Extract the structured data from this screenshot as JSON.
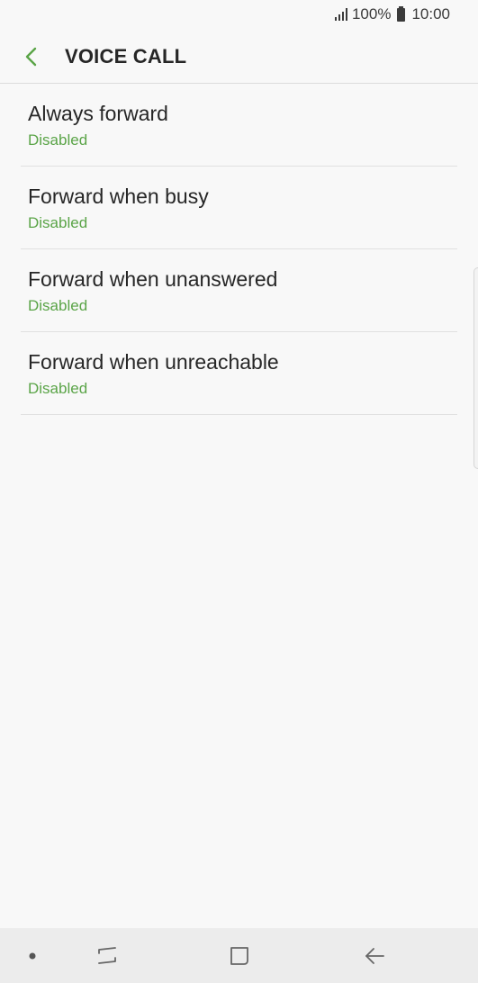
{
  "status_bar": {
    "battery_text": "100%",
    "time": "10:00",
    "icons": [
      "signal-icon",
      "battery-icon"
    ]
  },
  "header": {
    "back_icon": "chevron-left-icon",
    "title": "VOICE CALL"
  },
  "list": [
    {
      "title": "Always forward",
      "status": "Disabled"
    },
    {
      "title": "Forward when busy",
      "status": "Disabled"
    },
    {
      "title": "Forward when unanswered",
      "status": "Disabled"
    },
    {
      "title": "Forward when unreachable",
      "status": "Disabled"
    }
  ],
  "nav_bar": {
    "icons": [
      "dot-icon",
      "recent-apps-icon",
      "home-icon",
      "back-arrow-icon"
    ]
  },
  "colors": {
    "accent": "#5aa447",
    "background": "#f8f8f8",
    "text": "#262626",
    "nav_background": "#ececec"
  }
}
